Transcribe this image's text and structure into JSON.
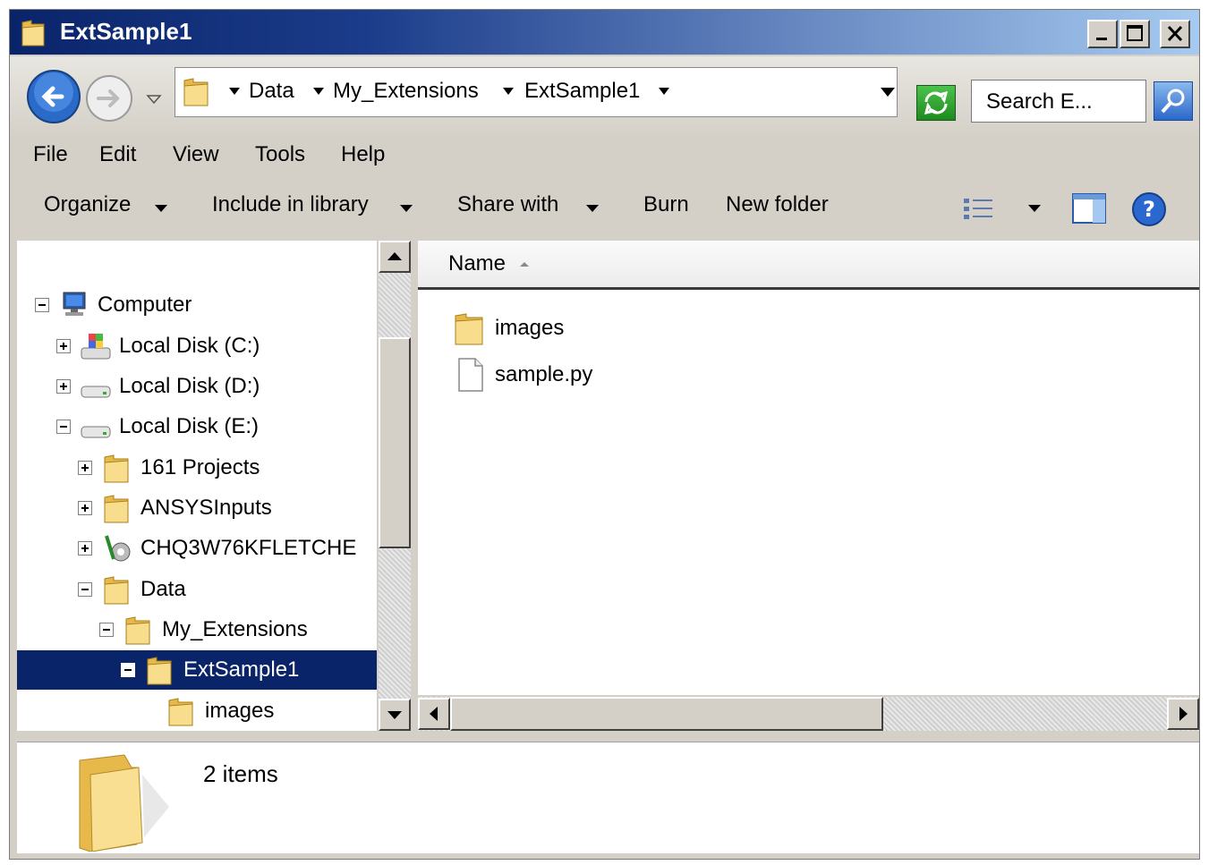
{
  "window": {
    "title": "ExtSample1"
  },
  "address": {
    "crumbs": [
      "Data",
      "My_Extensions",
      "ExtSample1"
    ],
    "search_placeholder": "Search E..."
  },
  "menubar": [
    "File",
    "Edit",
    "View",
    "Tools",
    "Help"
  ],
  "commandbar": {
    "organize": "Organize",
    "include": "Include in library",
    "share": "Share with",
    "burn": "Burn",
    "new_folder": "New folder"
  },
  "tree": [
    {
      "label": "Computer",
      "icon": "computer-icon",
      "expander": "minus"
    },
    {
      "label": "Local Disk (C:)",
      "icon": "system-drive-icon",
      "expander": "plus"
    },
    {
      "label": "Local Disk (D:)",
      "icon": "drive-icon",
      "expander": "plus"
    },
    {
      "label": "Local Disk (E:)",
      "icon": "drive-icon",
      "expander": "minus"
    },
    {
      "label": "161 Projects",
      "icon": "folder-icon",
      "expander": "plus"
    },
    {
      "label": "ANSYSInputs",
      "icon": "folder-icon",
      "expander": "plus"
    },
    {
      "label": "CHQ3W76KFLETCHE",
      "icon": "network-icon",
      "expander": "plus"
    },
    {
      "label": "Data",
      "icon": "folder-icon",
      "expander": "minus"
    },
    {
      "label": "My_Extensions",
      "icon": "folder-icon",
      "expander": "minus"
    },
    {
      "label": "ExtSample1",
      "icon": "folder-icon",
      "expander": "minus",
      "selected": true
    },
    {
      "label": "images",
      "icon": "folder-icon",
      "expander": "none"
    }
  ],
  "content": {
    "column_name": "Name",
    "items": [
      {
        "name": "images",
        "icon": "folder-icon"
      },
      {
        "name": "sample.py",
        "icon": "file-icon"
      }
    ]
  },
  "details": {
    "count": "2 items"
  },
  "colors": {
    "selection": "#0a246a",
    "title_start": "#0a246a",
    "title_end": "#a6caf0",
    "folder": "#f2d27a"
  }
}
